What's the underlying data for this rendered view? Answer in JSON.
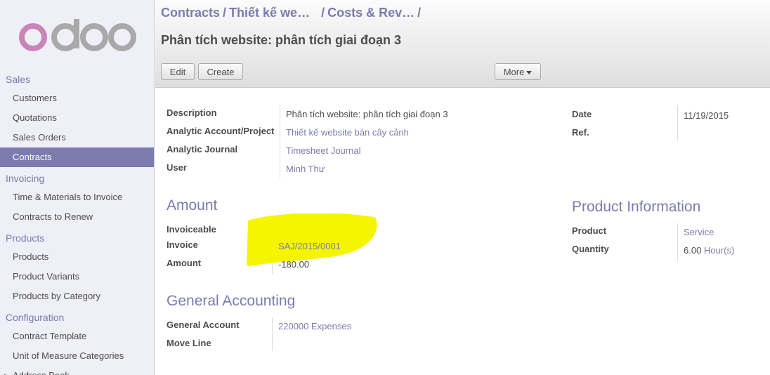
{
  "sidebar": {
    "sections": [
      {
        "title": "Sales",
        "items": [
          {
            "label": "Customers"
          },
          {
            "label": "Quotations"
          },
          {
            "label": "Sales Orders"
          },
          {
            "label": "Contracts",
            "active": true
          }
        ]
      },
      {
        "title": "Invoicing",
        "items": [
          {
            "label": "Time & Materials to Invoice"
          },
          {
            "label": "Contracts to Renew"
          }
        ]
      },
      {
        "title": "Products",
        "items": [
          {
            "label": "Products"
          },
          {
            "label": "Product Variants"
          },
          {
            "label": "Products by Category"
          }
        ]
      },
      {
        "title": "Configuration",
        "items": [
          {
            "label": "Contract Template"
          },
          {
            "label": "Unit of Measure Categories"
          },
          {
            "label": "Address Book"
          }
        ]
      }
    ]
  },
  "logo": {
    "text": "odoo"
  },
  "header": {
    "breadcrumb": [
      "Contracts",
      "Thiết kế we…",
      "Costs & Rev…"
    ],
    "separator": "/",
    "title": "Phân tích website: phân tích giai đoạn 3",
    "edit_label": "Edit",
    "create_label": "Create",
    "more_label": "More"
  },
  "form": {
    "description_label": "Description",
    "description_value": "Phân tích website: phân tích giai đoạn 3",
    "analytic_account_label": "Analytic Account/Project",
    "analytic_account_value": "Thiết kế website bán cây cảnh",
    "analytic_journal_label": "Analytic Journal",
    "analytic_journal_value": "Timesheet Journal",
    "user_label": "User",
    "user_value": "Minh Thư",
    "date_label": "Date",
    "date_value": "11/19/2015",
    "ref_label": "Ref.",
    "amount_heading": "Amount",
    "invoiceable_label": "Invoiceable",
    "invoice_label": "Invoice",
    "invoice_value": "SAJ/2015/0001",
    "amount_label": "Amount",
    "amount_value": "-180.00",
    "product_info_heading": "Product Information",
    "product_label": "Product",
    "product_value": "Service",
    "quantity_label": "Quantity",
    "quantity_value": "6.00",
    "quantity_uom": "Hour(s)",
    "general_accounting_heading": "General Accounting",
    "general_account_label": "General Account",
    "general_account_value": "220000 Expenses",
    "move_line_label": "Move Line"
  },
  "colors": {
    "accent": "#7c7bad",
    "highlight": "#f5f500"
  }
}
